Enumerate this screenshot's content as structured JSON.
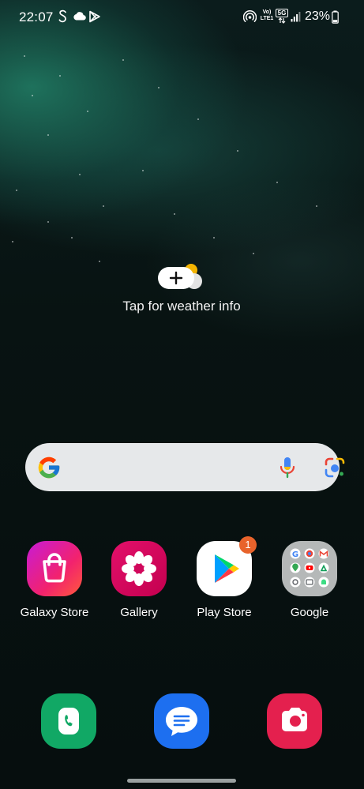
{
  "status_bar": {
    "time": "22:07",
    "network_labels": [
      "Vo)",
      "LTE1",
      "5G"
    ],
    "battery_percent": "23%"
  },
  "weather": {
    "label": "Tap for weather info"
  },
  "search_bar": {
    "icons": [
      "google-g-icon",
      "mic-icon",
      "lens-icon"
    ]
  },
  "apps": [
    {
      "label": "Galaxy Store",
      "icon": "galaxy-store-icon"
    },
    {
      "label": "Gallery",
      "icon": "gallery-icon"
    },
    {
      "label": "Play Store",
      "icon": "play-store-icon",
      "badge": "1"
    },
    {
      "label": "Google",
      "icon": "google-folder-icon"
    }
  ],
  "dock": [
    {
      "icon": "phone-icon"
    },
    {
      "icon": "messages-icon"
    },
    {
      "icon": "camera-icon"
    }
  ],
  "colors": {
    "badge": "#e8632b",
    "phone": "#11a865",
    "messages": "#1d6ff0",
    "camera": "#e4204e"
  }
}
